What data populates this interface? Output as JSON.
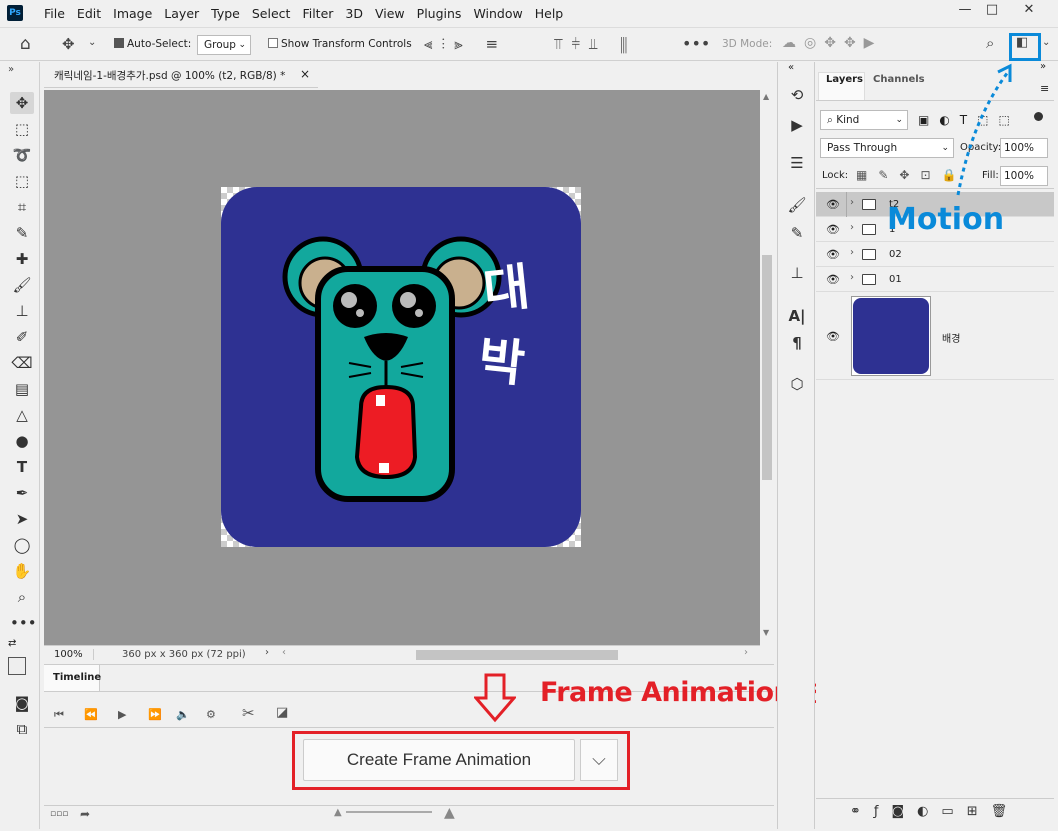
{
  "app": {
    "logo": "Ps",
    "menu": [
      "File",
      "Edit",
      "Image",
      "Layer",
      "Type",
      "Select",
      "Filter",
      "3D",
      "View",
      "Plugins",
      "Window",
      "Help"
    ]
  },
  "window_controls": {
    "minimize": "—",
    "restore": "□",
    "close": "✕"
  },
  "options": {
    "auto_select_label": "Auto-Select:",
    "group_value": "Group",
    "show_transform_label": "Show Transform Controls",
    "mode_3d_label": "3D Mode:"
  },
  "document": {
    "tab_title": "캐릭네임-1-배경추가.psd @ 100% (t2, RGB/8) *",
    "close": "×",
    "zoom": "100%",
    "info": "360 px x 360 px (72 ppi)"
  },
  "artwork": {
    "text_top": "대",
    "text_bottom": "박",
    "background_color": "#2e3192",
    "character_color": "#12a89d"
  },
  "timeline": {
    "tab": "Timeline",
    "create_button": "Create Frame Animation"
  },
  "annotations": {
    "frame_note": "Frame Animation 선택후 꼭!",
    "motion": "Motion",
    "accent": "#e32027",
    "blue": "#0a8ad9"
  },
  "layers_panel": {
    "tabs": [
      "Layers",
      "Channels"
    ],
    "filter_kind": "Kind",
    "blend_mode": "Pass Through",
    "opacity_label": "Opacity:",
    "opacity_value": "100%",
    "lock_label": "Lock:",
    "fill_label": "Fill:",
    "fill_value": "100%",
    "layers": [
      {
        "name": "t2",
        "type": "group",
        "selected": true
      },
      {
        "name": "1",
        "type": "group",
        "selected": false
      },
      {
        "name": "02",
        "type": "group",
        "selected": false
      },
      {
        "name": "01",
        "type": "group",
        "selected": false
      },
      {
        "name": "배경",
        "type": "image",
        "selected": false
      }
    ]
  }
}
